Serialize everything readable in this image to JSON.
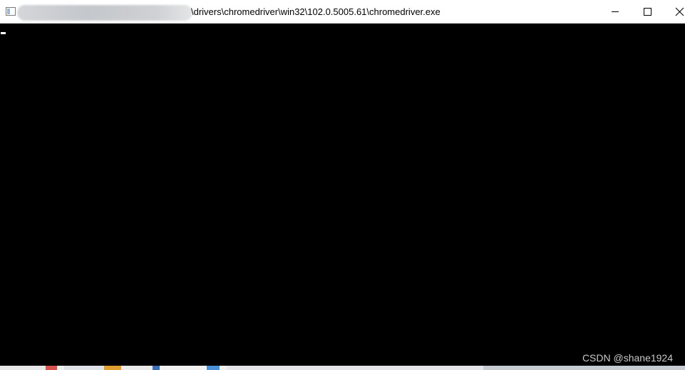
{
  "window": {
    "title": "\\drivers\\chromedriver\\win32\\102.0.5005.61\\chromedriver.exe",
    "controls": {
      "minimize_icon": "minimize-icon",
      "maximize_icon": "maximize-icon",
      "close_icon": "close-icon"
    }
  },
  "console": {
    "background": "#000000",
    "cursor_color": "#ffffff"
  },
  "watermark": {
    "text": "CSDN @shane1924"
  }
}
